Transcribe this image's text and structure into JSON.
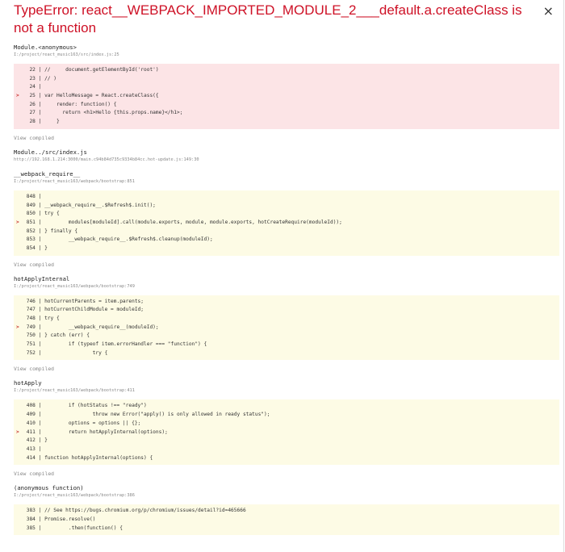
{
  "overlay": {
    "title": "TypeError: react__WEBPACK_IMPORTED_MODULE_2___default.a.createClass is not a function",
    "close_glyph": "×",
    "error_color": "#ce1126"
  },
  "frames": [
    {
      "fn": "Module.<anonymous>",
      "file": "I:/project/react_music163/src/index.js:25",
      "bg": "pink",
      "lines": [
        {
          "text": "  22 | //     document.getElementById('root')",
          "hl": false
        },
        {
          "text": "  23 | // )",
          "hl": false
        },
        {
          "text": "  24 |",
          "hl": false
        },
        {
          "text": "  25 | var HelloMessage = React.createClass({",
          "hl": true
        },
        {
          "text": "  26 |     render: function() {",
          "hl": false
        },
        {
          "text": "  27 |       return <h1>Hello {this.props.name}</h1>;",
          "hl": false
        },
        {
          "text": "  28 |     }",
          "hl": false
        }
      ],
      "view": "View compiled"
    },
    {
      "fn": "Module../src/index.js",
      "file": "http://192.168.1.214:3000/main.c94b84d735c9334b84cc.hot-update.js:149:30",
      "bg": "none",
      "lines": [],
      "view": ""
    },
    {
      "fn": "__webpack_require__",
      "file": "I:/project/react_music163/webpack/bootstrap:851",
      "bg": "yellow",
      "lines": [
        {
          "text": " 848 |",
          "hl": false
        },
        {
          "text": " 849 | __webpack_require__.$Refresh$.init();",
          "hl": false
        },
        {
          "text": " 850 | try {",
          "hl": false
        },
        {
          "text": " 851 |         modules[moduleId].call(module.exports, module, module.exports, hotCreateRequire(moduleId));",
          "hl": true
        },
        {
          "text": " 852 | } finally {",
          "hl": false
        },
        {
          "text": " 853 |         __webpack_require__.$Refresh$.cleanup(moduleId);",
          "hl": false
        },
        {
          "text": " 854 | }",
          "hl": false
        }
      ],
      "view": "View compiled"
    },
    {
      "fn": "hotApplyInternal",
      "file": "I:/project/react_music163/webpack/bootstrap:749",
      "bg": "yellow",
      "lines": [
        {
          "text": " 746 | hotCurrentParents = item.parents;",
          "hl": false
        },
        {
          "text": " 747 | hotCurrentChildModule = moduleId;",
          "hl": false
        },
        {
          "text": " 748 | try {",
          "hl": false
        },
        {
          "text": " 749 |         __webpack_require__(moduleId);",
          "hl": true
        },
        {
          "text": " 750 | } catch (err) {",
          "hl": false
        },
        {
          "text": " 751 |         if (typeof item.errorHandler === \"function\") {",
          "hl": false
        },
        {
          "text": " 752 |                 try {",
          "hl": false
        }
      ],
      "view": "View compiled"
    },
    {
      "fn": "hotApply",
      "file": "I:/project/react_music163/webpack/bootstrap:411",
      "bg": "yellow",
      "lines": [
        {
          "text": " 408 |         if (hotStatus !== \"ready\")",
          "hl": false
        },
        {
          "text": " 409 |                 throw new Error(\"apply() is only allowed in ready status\");",
          "hl": false
        },
        {
          "text": " 410 |         options = options || {};",
          "hl": false
        },
        {
          "text": " 411 |         return hotApplyInternal(options);",
          "hl": true
        },
        {
          "text": " 412 | }",
          "hl": false
        },
        {
          "text": " 413 |",
          "hl": false
        },
        {
          "text": " 414 | function hotApplyInternal(options) {",
          "hl": false
        }
      ],
      "view": "View compiled"
    },
    {
      "fn": "(anonymous function)",
      "file": "I:/project/react_music163/webpack/bootstrap:386",
      "bg": "yellow",
      "lines": [
        {
          "text": " 383 | // See https://bugs.chromium.org/p/chromium/issues/detail?id=465666",
          "hl": false
        },
        {
          "text": " 384 | Promise.resolve()",
          "hl": false
        },
        {
          "text": " 385 |         .then(function() {",
          "hl": false
        }
      ],
      "view": ""
    }
  ]
}
